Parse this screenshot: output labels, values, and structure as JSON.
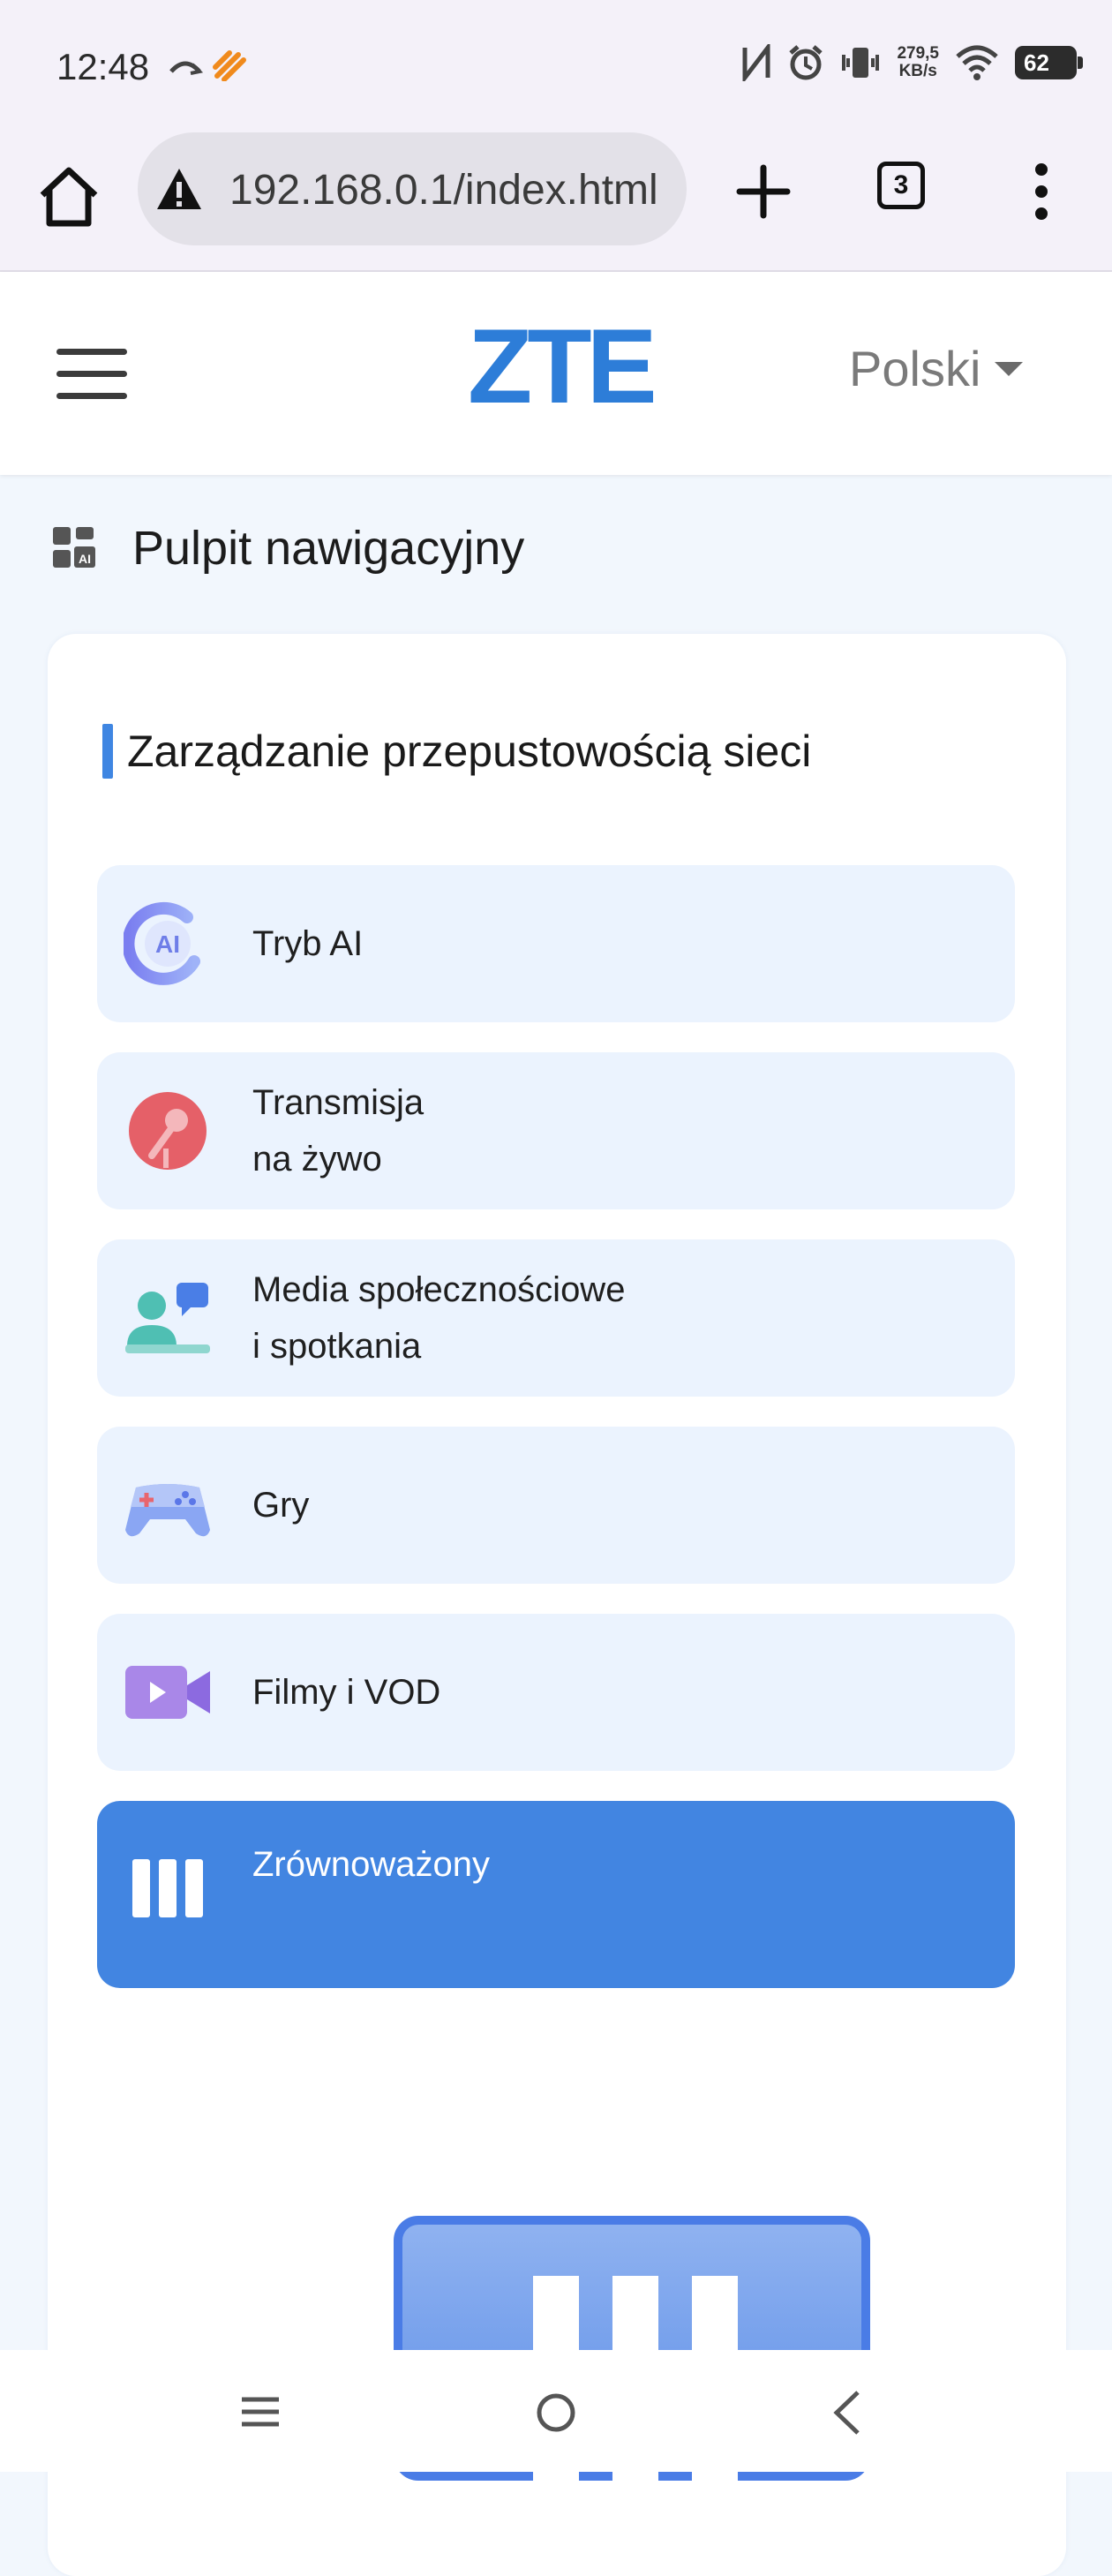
{
  "status_bar": {
    "time": "12:48",
    "net_speed_value": "279,5",
    "net_speed_unit": "KB/s",
    "battery": "62",
    "icons": [
      "call-forward-icon",
      "rocket-icon",
      "nfc-icon",
      "alarm-icon",
      "vibrate-icon",
      "wifi-icon",
      "battery-icon"
    ]
  },
  "browser": {
    "url": "192.168.0.1/index.html",
    "tab_count": "3",
    "icons": [
      "home-icon",
      "warning-icon",
      "plus-icon",
      "tabs-icon",
      "more-vert-icon"
    ]
  },
  "header": {
    "brand": "ZTE",
    "language": "Polski"
  },
  "page": {
    "title": "Pulpit nawigacyjny"
  },
  "section": {
    "title": "Zarządzanie przepustowością sieci",
    "modes": [
      {
        "line1": "Tryb AI",
        "line2": "",
        "icon": "ai-mode-icon"
      },
      {
        "line1": "Transmisja",
        "line2": "na żywo",
        "icon": "live-stream-icon"
      },
      {
        "line1": "Media społecznościowe",
        "line2": "i spotkania",
        "icon": "social-meeting-icon"
      },
      {
        "line1": "Gry",
        "line2": "",
        "icon": "gamepad-icon"
      },
      {
        "line1": "Filmy i VOD",
        "line2": "",
        "icon": "video-icon"
      },
      {
        "line1": "Zrównoważony",
        "line2": "",
        "icon": "balanced-icon",
        "active": true
      }
    ]
  },
  "colors": {
    "accent": "#4285e1",
    "brand": "#2d7dd8",
    "mode_bg": "#ebf3fe"
  }
}
